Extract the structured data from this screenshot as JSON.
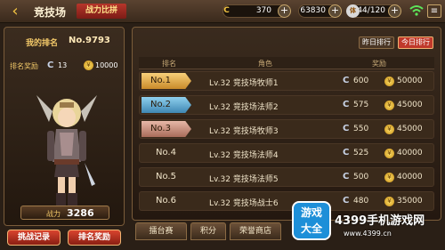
{
  "header": {
    "back_label": "‹",
    "title": "竞技场",
    "subtitle": "战力比拼",
    "resources": [
      {
        "icon": "C",
        "value": "370"
      },
      {
        "icon": "金",
        "value": "63830"
      },
      {
        "icon": "体",
        "value": "144/120"
      }
    ]
  },
  "player": {
    "rank_label": "我的排名",
    "rank_value": "No.9793",
    "reward_label": "排名奖励",
    "reward_c": "13",
    "reward_gold": "10000",
    "power_label": "战力",
    "power_value": "3286"
  },
  "buttons": {
    "challenge_log": "挑战记录",
    "rank_rewards": "排名奖励",
    "yesterday": "昨日排行",
    "today": "今日排行"
  },
  "table": {
    "headers": [
      "排名",
      "角色",
      "奖励"
    ],
    "rows": [
      {
        "rank": "No.1",
        "role": "Lv.32 竞技场牧师1",
        "c": "600",
        "gold": "50000"
      },
      {
        "rank": "No.2",
        "role": "Lv.32 竞技场法师2",
        "c": "575",
        "gold": "45000"
      },
      {
        "rank": "No.3",
        "role": "Lv.32 竞技场牧师3",
        "c": "550",
        "gold": "45000"
      },
      {
        "rank": "No.4",
        "role": "Lv.32 竞技场法师4",
        "c": "525",
        "gold": "40000"
      },
      {
        "rank": "No.5",
        "role": "Lv.32 竞技场法师5",
        "c": "500",
        "gold": "40000"
      },
      {
        "rank": "No.6",
        "role": "Lv.32 竞技场战士6",
        "c": "480",
        "gold": "35000"
      }
    ]
  },
  "tabs": [
    "擂台赛",
    "积分",
    "荣誉商店"
  ],
  "watermark": {
    "logo_top": "游戏",
    "logo_bottom": "大全",
    "title": "4399手机游戏网",
    "url": "www.4399.cn"
  },
  "colors": {
    "gold_badge": "#e7a93a",
    "blue_badge": "#4f9fc7",
    "bronze_badge": "#c98b73",
    "accent_red": "#b7362b"
  }
}
